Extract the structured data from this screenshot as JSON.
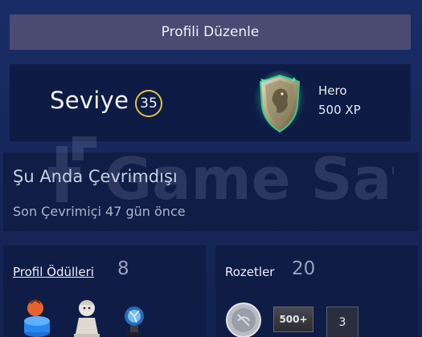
{
  "header": {
    "edit_profile_label": "Profili Düzenle"
  },
  "level": {
    "label": "Seviye",
    "value": "35",
    "badge_name": "Hero",
    "badge_xp": "500 XP",
    "badge_icon": "lion-shield-icon"
  },
  "watermark": {
    "text": "Game Satış"
  },
  "status": {
    "title": "Şu Anda Çevrimdışı",
    "last_online": "Son Çevrimiçi 47 gün önce"
  },
  "rewards": {
    "title": "Profil Ödülleri",
    "count": "8",
    "items": [
      {
        "icon": "orange-blue-figure-icon"
      },
      {
        "icon": "bust-statue-icon"
      },
      {
        "icon": "plasma-orb-icon"
      }
    ]
  },
  "badges": {
    "title": "Rozetler",
    "count": "20",
    "items": [
      {
        "icon": "silver-coin-icon"
      },
      {
        "label": "500+"
      },
      {
        "label": "3"
      }
    ]
  },
  "colors": {
    "background": "#16275e",
    "panel": "#0e1b44",
    "level_ring": "#e0c44a",
    "shield_glow": "#3fd9a0"
  }
}
